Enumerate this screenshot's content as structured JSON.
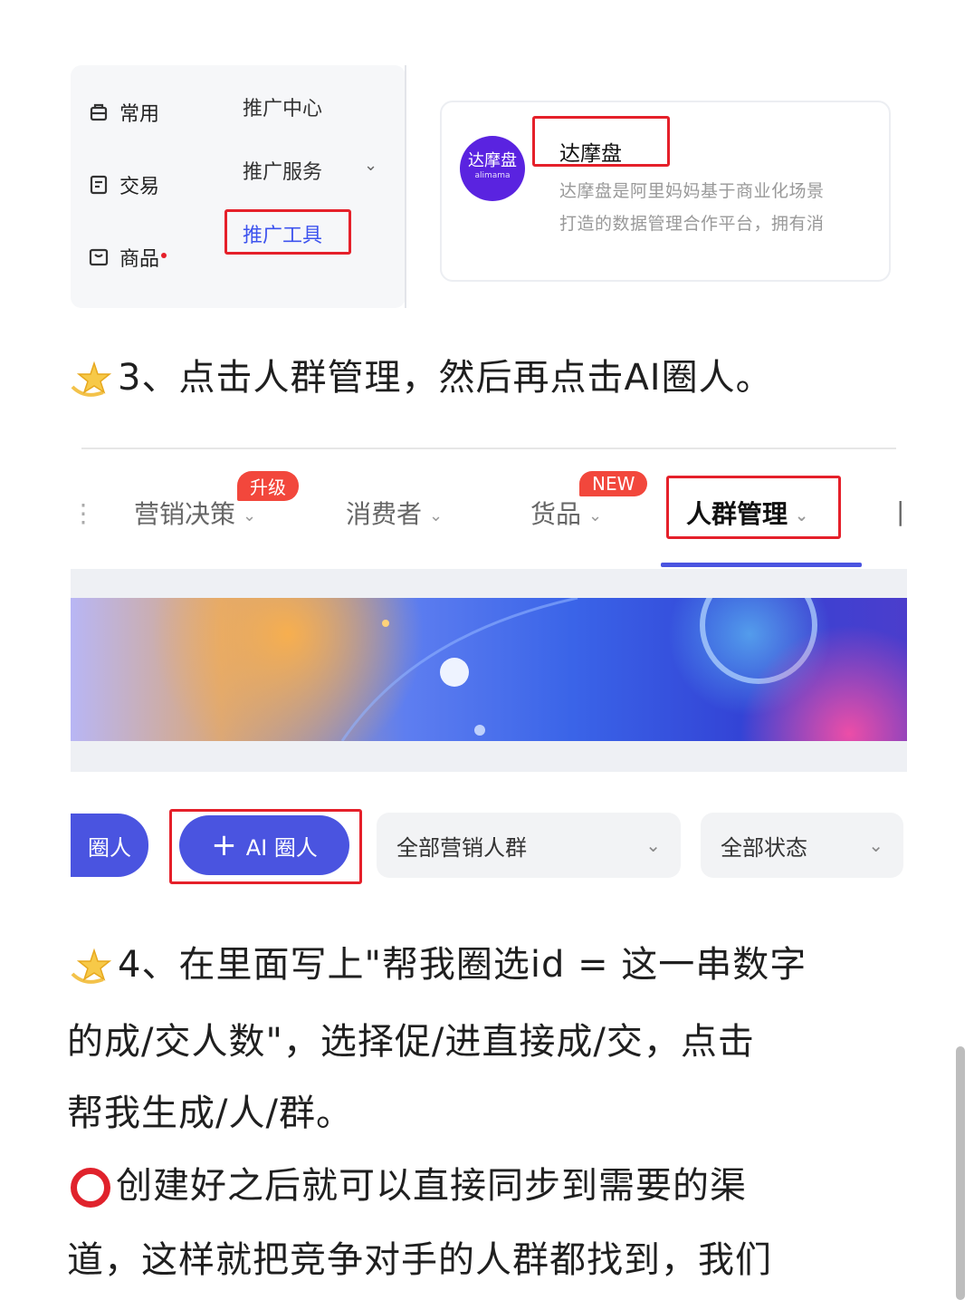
{
  "screenshot1": {
    "menu": [
      {
        "label": "常用",
        "icon": "bookmark-icon"
      },
      {
        "label": "交易",
        "icon": "document-icon"
      },
      {
        "label": "商品",
        "icon": "box-icon"
      }
    ],
    "submenu": [
      {
        "label": "推广中心"
      },
      {
        "label": "推广服务"
      },
      {
        "label": "推广工具"
      }
    ],
    "card": {
      "logo_text": "达摩盘",
      "logo_sub": "alimama",
      "title": "达摩盘",
      "desc_line1": "达摩盘是阿里妈妈基于商业化场景",
      "desc_line2": "打造的数据管理合作平台，拥有消"
    }
  },
  "step3": "3、点击人群管理，然后再点击AI圈人。",
  "screenshot2": {
    "tabs": [
      {
        "label": "营销决策",
        "badge": "升级"
      },
      {
        "label": "消费者",
        "badge": ""
      },
      {
        "label": "货品",
        "badge": "NEW"
      },
      {
        "label": "人群管理",
        "badge": ""
      }
    ],
    "partial_left_button": "圈人",
    "ai_button": "AI 圈人",
    "select_group": "全部营销人群",
    "select_status": "全部状态"
  },
  "step4_line1": "4、在里面写上\"帮我圈选id = 这一串数字",
  "step4_line2": "的成/交人数\"，选择促/进直接成/交，点击",
  "step4_line3": "帮我生成/人/群。",
  "note_line1": "创建好之后就可以直接同步到需要的渠",
  "note_line2": "道，这样就把竞争对手的人群都找到，我们",
  "colors": {
    "accent": "#4a54e0",
    "highlight_box": "#e5202a",
    "badge": "#f2473c"
  }
}
